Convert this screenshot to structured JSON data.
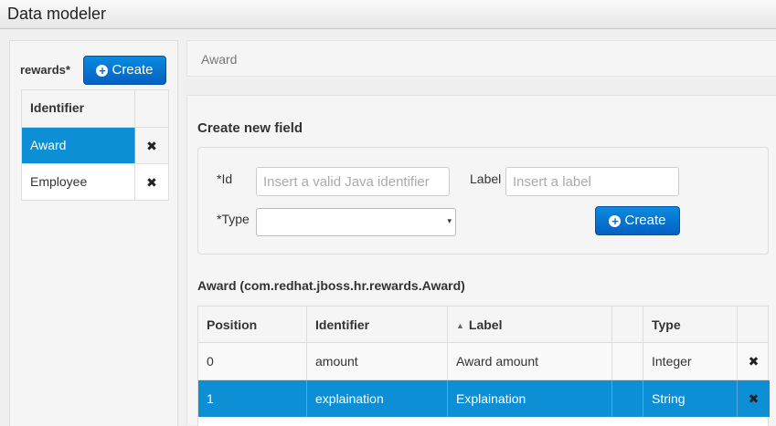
{
  "window": {
    "title": "Data modeler"
  },
  "project": {
    "name": "rewards*",
    "create_label": "Create"
  },
  "entity_list": {
    "header": "Identifier",
    "items": [
      {
        "label": "Award",
        "selected": true,
        "remove_icon": "remove-icon"
      },
      {
        "label": "Employee",
        "selected": false,
        "remove_icon": "remove-icon"
      }
    ]
  },
  "breadcrumb": {
    "label": "Award"
  },
  "new_field": {
    "title": "Create new field",
    "id_label": "*Id",
    "id_placeholder": "Insert a valid Java identifier",
    "label_label": "Label",
    "label_placeholder": "Insert a label",
    "type_label": "*Type",
    "type_value": "",
    "create_label": "Create"
  },
  "fields_table": {
    "title": "Award (com.redhat.jboss.hr.rewards.Award)",
    "columns": [
      "Position",
      "Identifier",
      "Label",
      "",
      "Type",
      ""
    ],
    "sorted_column": "Label",
    "rows": [
      {
        "position": "0",
        "identifier": "amount",
        "label": "Award amount",
        "type": "Integer",
        "selected": false
      },
      {
        "position": "1",
        "identifier": "explaination",
        "label": "Explaination",
        "type": "String",
        "selected": true
      }
    ]
  },
  "colors": {
    "primary": "#0a6ccf",
    "selection": "#0c8fd4"
  }
}
